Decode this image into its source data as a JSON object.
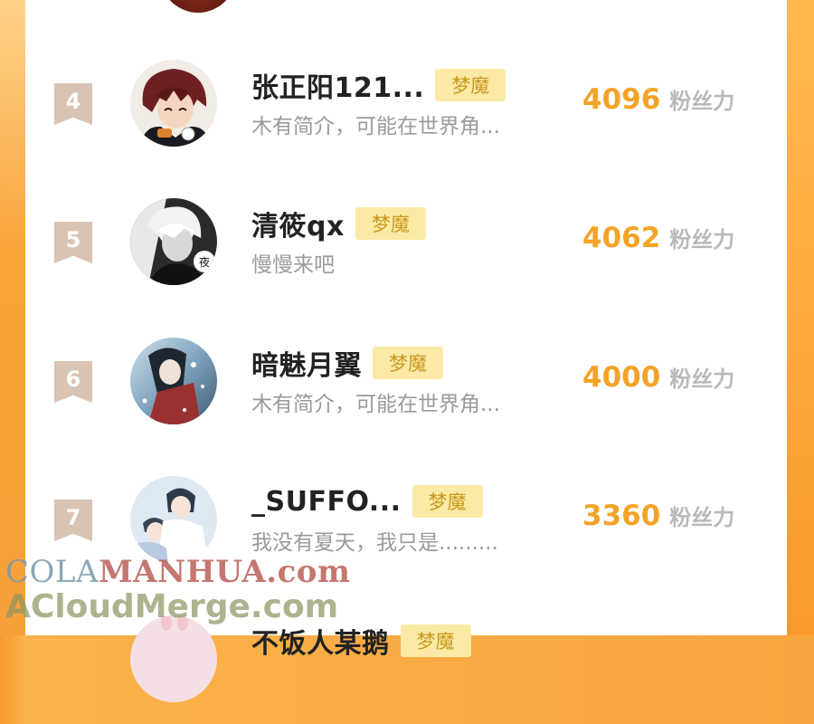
{
  "colors": {
    "score": "#f3a327",
    "badge_bg": "#fbeaa6",
    "badge_text": "#c99a20",
    "rank_flag": "#d9c3b2",
    "frame_orange": "#f99a2e"
  },
  "rows": [
    {
      "rank": "4",
      "name": "张正阳121...",
      "badge": "梦魔",
      "bio": "木有简介，可能在世界角...",
      "score": "4096",
      "unit": "粉丝力"
    },
    {
      "rank": "5",
      "name": "清筱qx",
      "badge": "梦魔",
      "bio": "慢慢来吧",
      "score": "4062",
      "unit": "粉丝力"
    },
    {
      "rank": "6",
      "name": "暗魅月翼",
      "badge": "梦魔",
      "bio": "木有简介，可能在世界角...",
      "score": "4000",
      "unit": "粉丝力"
    },
    {
      "rank": "7",
      "name": "_SUFFO...",
      "badge": "梦魔",
      "bio": "我没有夏天，我只是.........",
      "score": "3360",
      "unit": "粉丝力"
    },
    {
      "name": "不饭人某鹅",
      "badge": "梦魔"
    }
  ],
  "avatar_mark": "夜",
  "watermark": {
    "line1_a": "COLA",
    "line1_b": "MANHUA.com",
    "line2": "ACloudMerge.com"
  }
}
